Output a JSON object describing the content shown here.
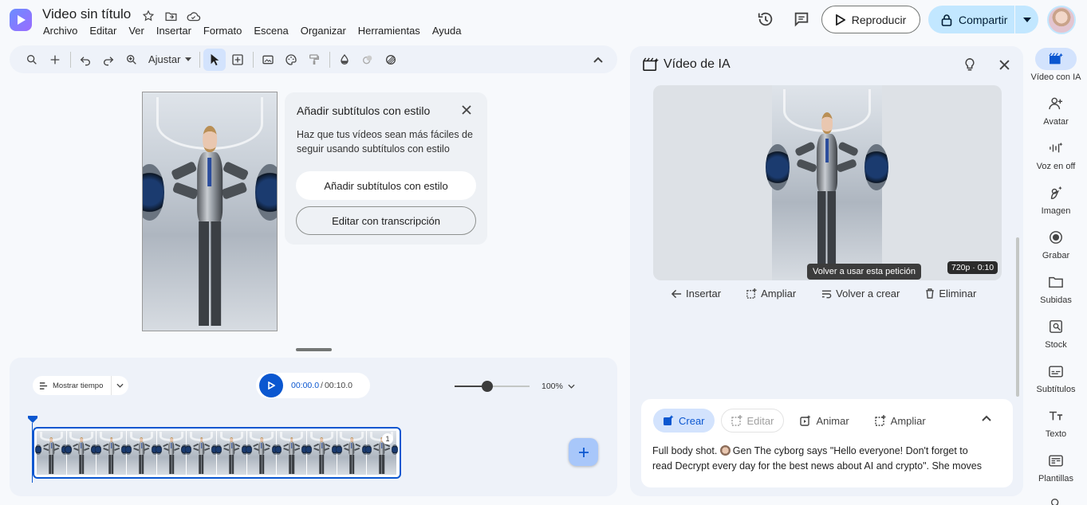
{
  "header": {
    "title": "Video sin título",
    "menu": [
      "Archivo",
      "Editar",
      "Ver",
      "Insertar",
      "Formato",
      "Escena",
      "Organizar",
      "Herramientas",
      "Ayuda"
    ],
    "play_label": "Reproducir",
    "share_label": "Compartir",
    "accent_color": "#0b57d0",
    "share_bg": "#c2e7ff"
  },
  "toolbar": {
    "zoom_select": "Ajustar",
    "icons": [
      "search-icon",
      "plus-icon",
      "undo-icon",
      "redo-icon",
      "zoom-icon",
      "select-pointer-icon",
      "text-box-icon",
      "image-icon",
      "palette-icon",
      "paint-format-icon",
      "fill-icon",
      "eraser-icon",
      "mask-icon",
      "chevron-up-icon"
    ]
  },
  "subtitle_popup": {
    "title": "Añadir subtítulos con estilo",
    "description": "Haz que tus vídeos sean más fáciles de seguir usando subtítulos con estilo",
    "primary_button": "Añadir subtítulos con estilo",
    "secondary_button": "Editar con transcripción"
  },
  "timeline": {
    "show_time_label": "Mostrar tiempo",
    "time_current": "00:00.0",
    "time_separator": "/",
    "time_total": "00:10.0",
    "zoom_level": "100%",
    "zoom_slider_fraction": 0.44,
    "clip_number": "1",
    "clip_frame_count": 12
  },
  "ai_panel": {
    "title": "Vídeo de IA",
    "resolution_badge": "720p · 0:10",
    "tooltip": "Volver a usar esta petición",
    "actions": [
      "Insertar",
      "Ampliar",
      "Volver a crear",
      "Eliminar"
    ],
    "tabs": [
      "Crear",
      "Editar",
      "Animar",
      "Ampliar"
    ],
    "prompt_before": "Full body shot. ",
    "prompt_mention": "Gen",
    "prompt_after": " The cyborg says \"Hello everyone! Don't forget to read Decrypt every day for the best news about AI and crypto\". She moves"
  },
  "rail": {
    "items": [
      "Vídeo con IA",
      "Avatar",
      "Voz en off",
      "Imagen",
      "Grabar",
      "Subidas",
      "Stock",
      "Subtítulos",
      "Texto",
      "Plantillas"
    ]
  }
}
